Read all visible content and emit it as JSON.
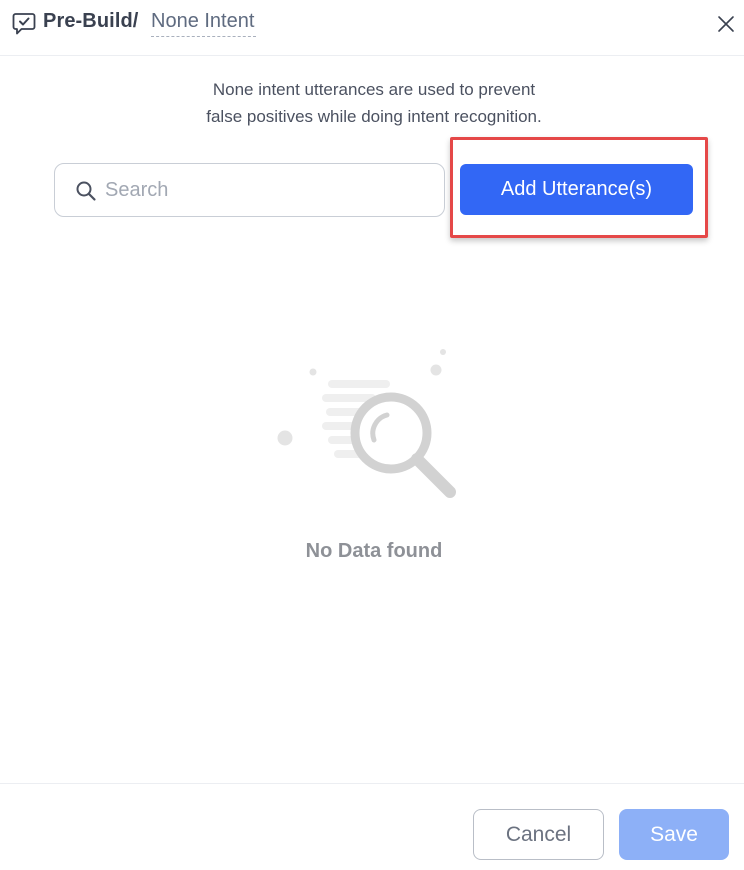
{
  "header": {
    "icon": "chat-check-icon",
    "breadcrumb_prefix": "Pre-Build/",
    "intent_name": "None Intent",
    "close_icon": "close-icon"
  },
  "description": {
    "line1": "None intent utterances are used to prevent",
    "line2": "false positives while doing intent recognition."
  },
  "search": {
    "placeholder": "Search",
    "value": "",
    "icon": "search-icon"
  },
  "actions": {
    "add_label": "Add Utterance(s)"
  },
  "empty_state": {
    "icon": "magnifier-illustration",
    "message": "No Data found"
  },
  "footer": {
    "cancel_label": "Cancel",
    "save_label": "Save"
  },
  "colors": {
    "primary": "#3267f5",
    "primary_disabled": "#8db0f7",
    "highlight": "#e54848",
    "muted_text": "#8e9197"
  }
}
